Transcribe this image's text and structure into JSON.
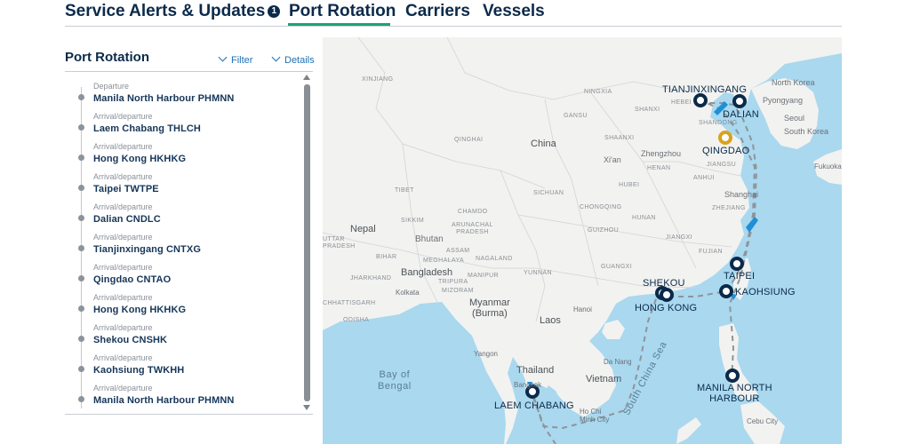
{
  "tabs": [
    {
      "label": "Service Alerts & Updates",
      "badge": "1"
    },
    {
      "label": "Port Rotation"
    },
    {
      "label": "Carriers"
    },
    {
      "label": "Vessels"
    }
  ],
  "panel": {
    "title": "Port Rotation",
    "filter_label": "Filter",
    "details_label": "Details"
  },
  "stops": [
    {
      "type": "Departure",
      "name": "Manila North Harbour  PHMNN"
    },
    {
      "type": "Arrival/departure",
      "name": "Laem Chabang  THLCH"
    },
    {
      "type": "Arrival/departure",
      "name": "Hong Kong  HKHKG"
    },
    {
      "type": "Arrival/departure",
      "name": "Taipei  TWTPE"
    },
    {
      "type": "Arrival/departure",
      "name": "Dalian  CNDLC"
    },
    {
      "type": "Arrival/departure",
      "name": "Tianjinxingang  CNTXG"
    },
    {
      "type": "Arrival/departure",
      "name": "Qingdao  CNTAO"
    },
    {
      "type": "Arrival/departure",
      "name": "Hong Kong  HKHKG"
    },
    {
      "type": "Arrival/departure",
      "name": "Shekou  CNSHK"
    },
    {
      "type": "Arrival/departure",
      "name": "Kaohsiung  TWKHH"
    },
    {
      "type": "Arrival/departure",
      "name": "Manila North Harbour  PHMNN"
    }
  ],
  "map": {
    "labels": {
      "china": "China",
      "nepal": "Nepal",
      "bhutan": "Bhutan",
      "bangladesh": "Bangladesh",
      "myanmar": "Myanmar\n(Burma)",
      "laos": "Laos",
      "thailand": "Thailand",
      "vietnam": "Vietnam",
      "bay_of_bengal": "Bay of\nBengal",
      "south_china_sea": "South China Sea",
      "north_korea": "North Korea",
      "south_korea": "South Korea",
      "seoul": "Seoul",
      "pyongyang": "Pyongyang",
      "shanghai": "Shanghai",
      "zhengzhou": "Zhengzhou",
      "xian": "Xi'an",
      "hanoi": "Hanoi",
      "yangon": "Yangon",
      "kolkata": "Kolkata",
      "da_nang": "Da Nang",
      "ho_chi_minh": "Ho Chi\nMinh City",
      "bangkok": "Bangkok",
      "cebu": "Cebu City",
      "fukuoka": "Fukuoka",
      "qinghai": "QINGHAI",
      "shaanxi": "SHAANXI",
      "shanxi": "SHANXI",
      "hebei": "HEBEI",
      "henan": "HENAN",
      "hubei": "HUBEI",
      "anhui": "ANHUI",
      "sichuan": "SICHUAN",
      "tibet": "TIBET",
      "chongqing": "CHONGQING",
      "hunan": "HUNAN",
      "jiangxi": "JIANGXI",
      "guizhou": "GUIZHOU",
      "yunnan": "YUNNAN",
      "guangxi": "GUANGXI",
      "fujian": "FUJIAN",
      "zhejiang": "ZHEJIANG",
      "jiangsu": "JIANGSU",
      "shandong": "SHANDONG",
      "gansu": "GANSU",
      "ningxia": "NINGXIA",
      "xinjiang": "XINJIANG",
      "arunachal": "ARUNACHAL\nPRADESH",
      "assam": "ASSAM",
      "bihar": "BIHAR",
      "meghalaya": "MEGHALAYA",
      "manipur": "MANIPUR",
      "mizoram": "MIZORAM",
      "tripura": "TRIPURA",
      "chhattisgarh": "CHHATTISGARH",
      "odisha": "ODISHA",
      "jharkhand": "JHARKHAND",
      "up": "UTTAR\nPRADESH",
      "nagaland": "NAGALAND",
      "sikkim": "SIKKIM",
      "chamdo": "CHAMDO"
    },
    "ports": {
      "tianjinxingang": "TIANJINXINGANG",
      "dalian": "DALIAN",
      "qingdao": "QINGDAO",
      "taipei": "TAIPEI",
      "shekou": "SHEKOU",
      "hong_kong": "HONG KONG",
      "kaohsiung": "KAOHSIUNG",
      "manila": "MANILA NORTH\nHARBOUR",
      "laem_chabang": "LAEM CHABANG"
    },
    "colors": {
      "water": "#a9d8ef",
      "land": "#f2f2f0",
      "port_marker": "#0b2a4a",
      "current_port_marker": "#d9a21c",
      "route": "#8e949a",
      "vessel": "#1f8fd6"
    }
  }
}
